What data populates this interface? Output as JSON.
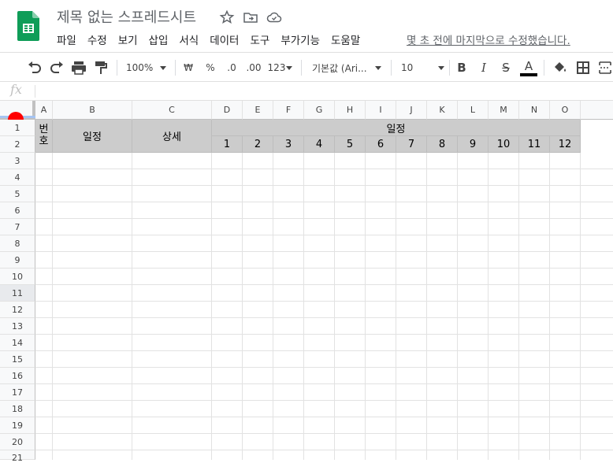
{
  "app": {
    "title": "제목 없는 스프레드시트",
    "last_edit": "몇 초 전에 마지막으로 수정했습니다.",
    "brand_color": "#0f9d58"
  },
  "menu": [
    "파일",
    "수정",
    "보기",
    "삽입",
    "서식",
    "데이터",
    "도구",
    "부가기능",
    "도움말"
  ],
  "toolbar": {
    "zoom": "100%",
    "currency": "₩",
    "percent": "%",
    "dec_decrease": ".0",
    "dec_increase": ".00",
    "format_more": "123",
    "font": "기본값 (Ari...",
    "font_size": "10",
    "bold": "B",
    "italic": "I",
    "strike": "S",
    "text_color": "A"
  },
  "formula_bar": {
    "label": "fx",
    "value": ""
  },
  "columns": [
    "A",
    "B",
    "C",
    "D",
    "E",
    "F",
    "G",
    "H",
    "I",
    "J",
    "K",
    "L",
    "M",
    "N",
    "O"
  ],
  "rows": [
    "1",
    "2",
    "3",
    "4",
    "5",
    "6",
    "7",
    "8",
    "9",
    "10",
    "11",
    "12",
    "13",
    "14",
    "15",
    "16",
    "17",
    "18",
    "19",
    "20",
    "21"
  ],
  "sheet": {
    "header_number": "번호",
    "header_schedule": "일정",
    "header_detail": "상세",
    "header_schedule_group": "일정",
    "months": [
      "1",
      "2",
      "3",
      "4",
      "5",
      "6",
      "7",
      "8",
      "9",
      "10",
      "11",
      "12"
    ],
    "header_fill": "#cccccc"
  }
}
